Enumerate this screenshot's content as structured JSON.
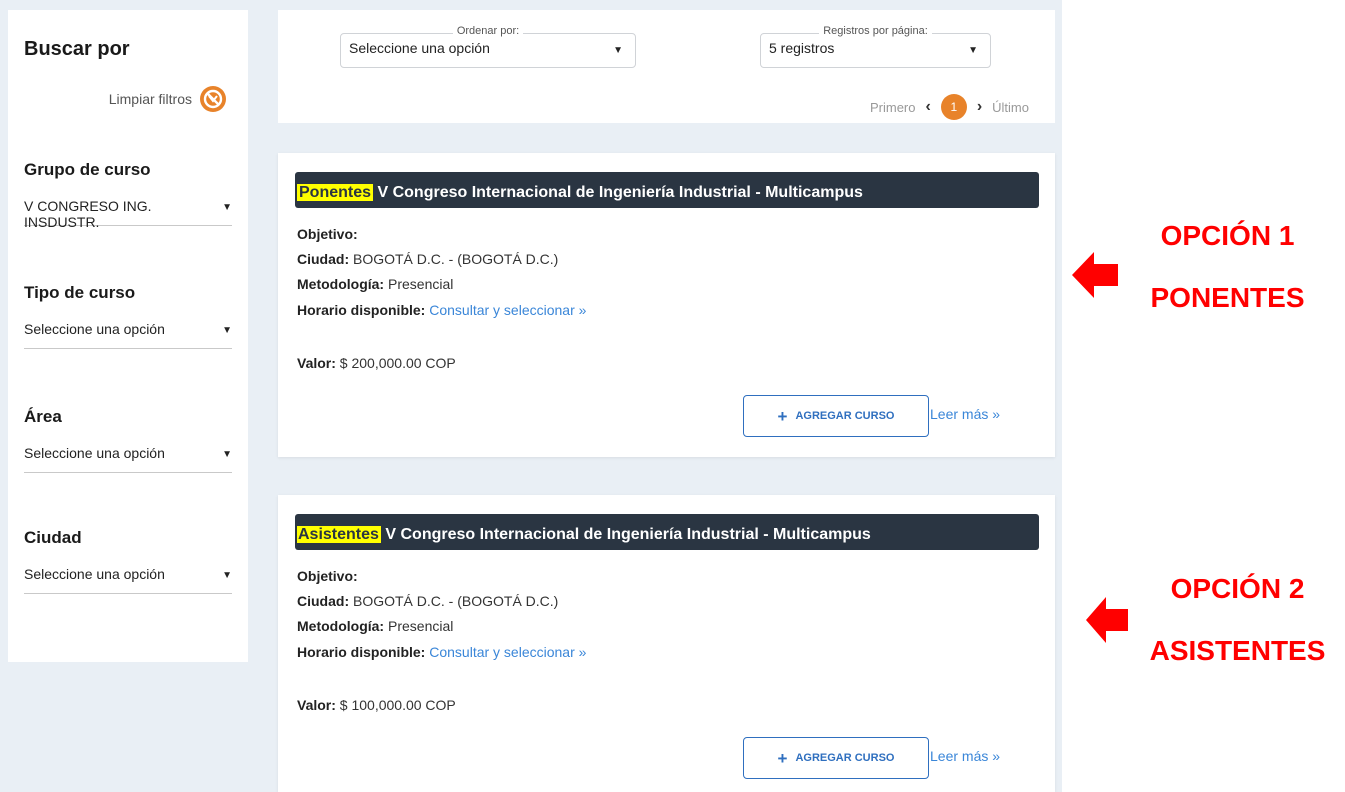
{
  "sidebar": {
    "title": "Buscar por",
    "clear_label": "Limpiar filtros",
    "filters": [
      {
        "label": "Grupo de curso",
        "value": "V CONGRESO ING. INSDUSTR."
      },
      {
        "label": "Tipo de curso",
        "value": "Seleccione una opción"
      },
      {
        "label": "Área",
        "value": "Seleccione una opción"
      },
      {
        "label": "Ciudad",
        "value": "Seleccione una opción"
      }
    ]
  },
  "topbar": {
    "sort_label": "Ordenar por:",
    "sort_value": "Seleccione una opción",
    "per_page_label": "Registros por página:",
    "per_page_value": "5 registros",
    "pager": {
      "first": "Primero",
      "page": "1",
      "last": "Último"
    }
  },
  "courses": [
    {
      "highlight": "Ponentes",
      "title": "V Congreso Internacional de Ingeniería Industrial - Multicampus",
      "objetivo_label": "Objetivo:",
      "ciudad_label": "Ciudad:",
      "ciudad": "BOGOTÁ D.C. - (BOGOTÁ D.C.)",
      "metodologia_label": "Metodología:",
      "metodologia": "Presencial",
      "horario_label": "Horario disponible:",
      "horario_link": "Consultar y seleccionar »",
      "valor_label": "Valor:",
      "valor": "$ 200,000.00 COP",
      "add_button": "AGREGAR CURSO",
      "more_link": "Leer más »"
    },
    {
      "highlight": "Asistentes",
      "title": "V Congreso Internacional de Ingeniería Industrial - Multicampus",
      "objetivo_label": "Objetivo:",
      "ciudad_label": "Ciudad:",
      "ciudad": "BOGOTÁ D.C. - (BOGOTÁ D.C.)",
      "metodologia_label": "Metodología:",
      "metodologia": "Presencial",
      "horario_label": "Horario disponible:",
      "horario_link": "Consultar y seleccionar »",
      "valor_label": "Valor:",
      "valor": "$ 100,000.00 COP",
      "add_button": "AGREGAR CURSO",
      "more_link": "Leer más »"
    }
  ],
  "annotations": [
    {
      "line1": "OPCIÓN 1",
      "line2": "PONENTES"
    },
    {
      "line1": "OPCIÓN 2",
      "line2": "ASISTENTES"
    }
  ],
  "colors": {
    "accent": "#e8832a",
    "title_bar": "#2a3542",
    "link": "#3a86d8",
    "highlight": "#ffff00",
    "annotation": "#ff0000"
  }
}
